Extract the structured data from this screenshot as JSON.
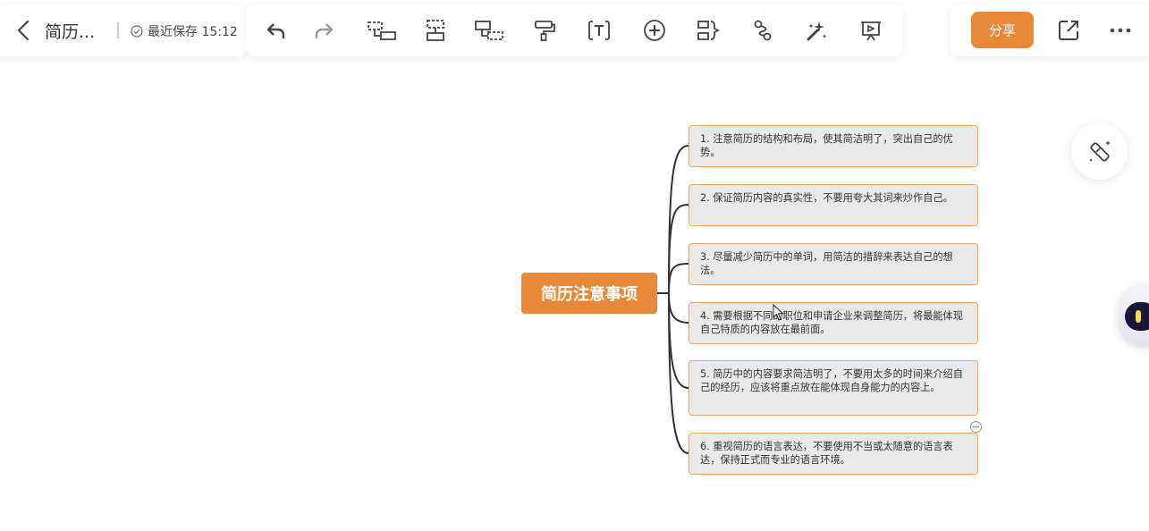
{
  "header": {
    "doc_title": "简历...",
    "save_status": "最近保存 15:12"
  },
  "toolbar": {
    "buttons": [
      {
        "name": "undo-icon"
      },
      {
        "name": "redo-icon"
      },
      {
        "name": "add-child-node-icon"
      },
      {
        "name": "add-sibling-node-icon"
      },
      {
        "name": "add-parent-node-icon"
      },
      {
        "name": "format-painter-icon"
      },
      {
        "name": "text-icon"
      },
      {
        "name": "insert-icon"
      },
      {
        "name": "summary-icon"
      },
      {
        "name": "relation-line-icon"
      },
      {
        "name": "magic-style-icon"
      },
      {
        "name": "presentation-icon"
      }
    ]
  },
  "actions": {
    "share_label": "分享"
  },
  "mindmap": {
    "root": "简历注意事项",
    "children": [
      "1. 注意简历的结构和布局，使其简洁明了，突出自己的优势。",
      "2. 保证简历内容的真实性，不要用夸大其词来炒作自己。",
      "3. 尽量减少简历中的单词，用简洁的措辞来表达自己的想法。",
      "4. 需要根据不同的职位和申请企业来调整简历，将最能体现自己特质的内容放在最前面。",
      "5. 简历中的内容要求简洁明了，不要用太多的时间来介绍自己的经历，应该将重点放在能体现自身能力的内容上。",
      "6. 重视简历的语言表达，不要使用不当或太随意的语言表达，保持正式而专业的语言环境。"
    ]
  },
  "colors": {
    "accent": "#e8893a",
    "node_border": "#f0a560",
    "node_bg": "#e9e9e9"
  }
}
